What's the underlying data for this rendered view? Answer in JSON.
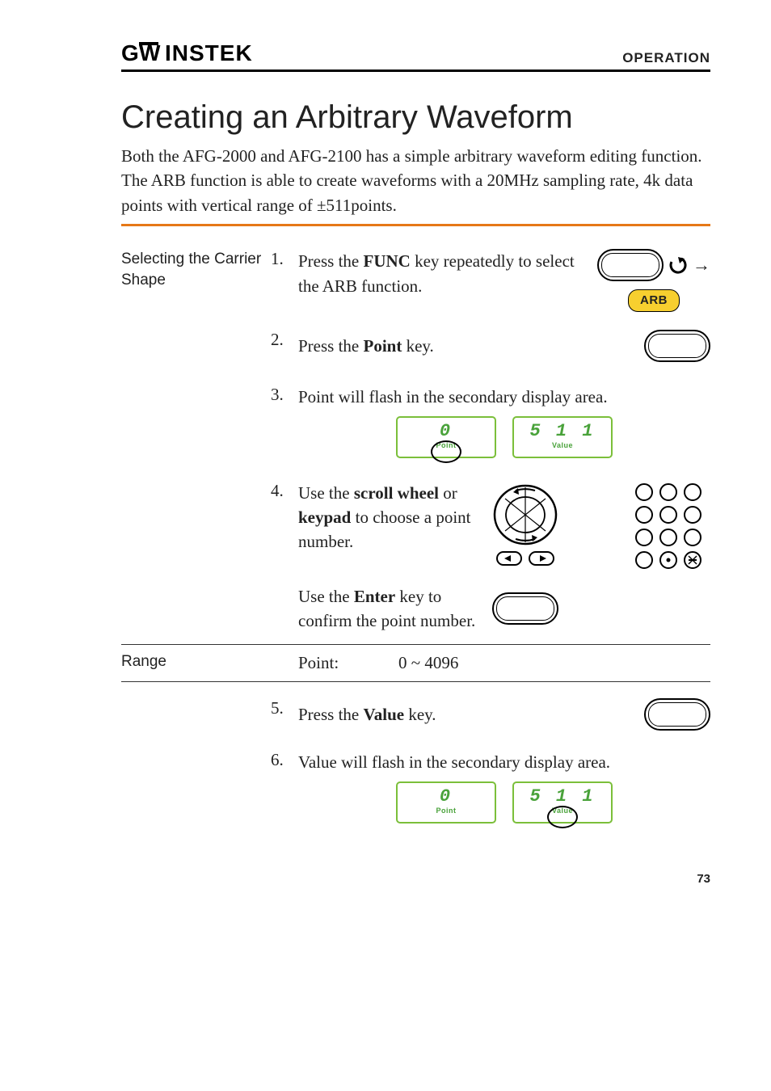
{
  "header": {
    "brand": "GWINSTEK",
    "section": "OPERATION"
  },
  "title": "Creating an Arbitrary Waveform",
  "intro": "Both the AFG-2000 and AFG-2100 has a simple arbitrary waveform editing function. The ARB function is able to create waveforms with a 20MHz sampling rate, 4k data points with vertical range of ±511points.",
  "side_heading": "Selecting the Carrier Shape",
  "steps": {
    "s1_num": "1.",
    "s1_a": "Press the ",
    "s1_b": "FUNC",
    "s1_c": " key repeatedly to select the ARB function.",
    "s1_badge": "ARB",
    "s2_num": "2.",
    "s2_a": "Press the ",
    "s2_b": "Point",
    "s2_c": " key.",
    "s3_num": "3.",
    "s3_a": "Point will flash in the secondary display area.",
    "s3_point_val": "0",
    "s3_point_lbl": "Point",
    "s3_value_val": "5 1 1",
    "s3_value_lbl": "Value",
    "s4_num": "4.",
    "s4_a": "Use the ",
    "s4_b": "scroll wheel",
    "s4_c": " or ",
    "s4_d": "keypad",
    "s4_e": " to choose a point number.",
    "s4b_a": "Use the ",
    "s4b_b": "Enter",
    "s4b_c": " key to confirm the point number.",
    "s5_num": "5.",
    "s5_a": "Press the ",
    "s5_b": "Value",
    "s5_c": " key.",
    "s6_num": "6.",
    "s6_a": "Value will flash in the secondary display area.",
    "s6_point_val": "0",
    "s6_point_lbl": "Point",
    "s6_value_val": "5 1 1",
    "s6_value_lbl": "Value"
  },
  "range": {
    "label": "Range",
    "key": "Point:",
    "val": "0 ~ 4096"
  },
  "page_number": "73",
  "arrow": "→"
}
